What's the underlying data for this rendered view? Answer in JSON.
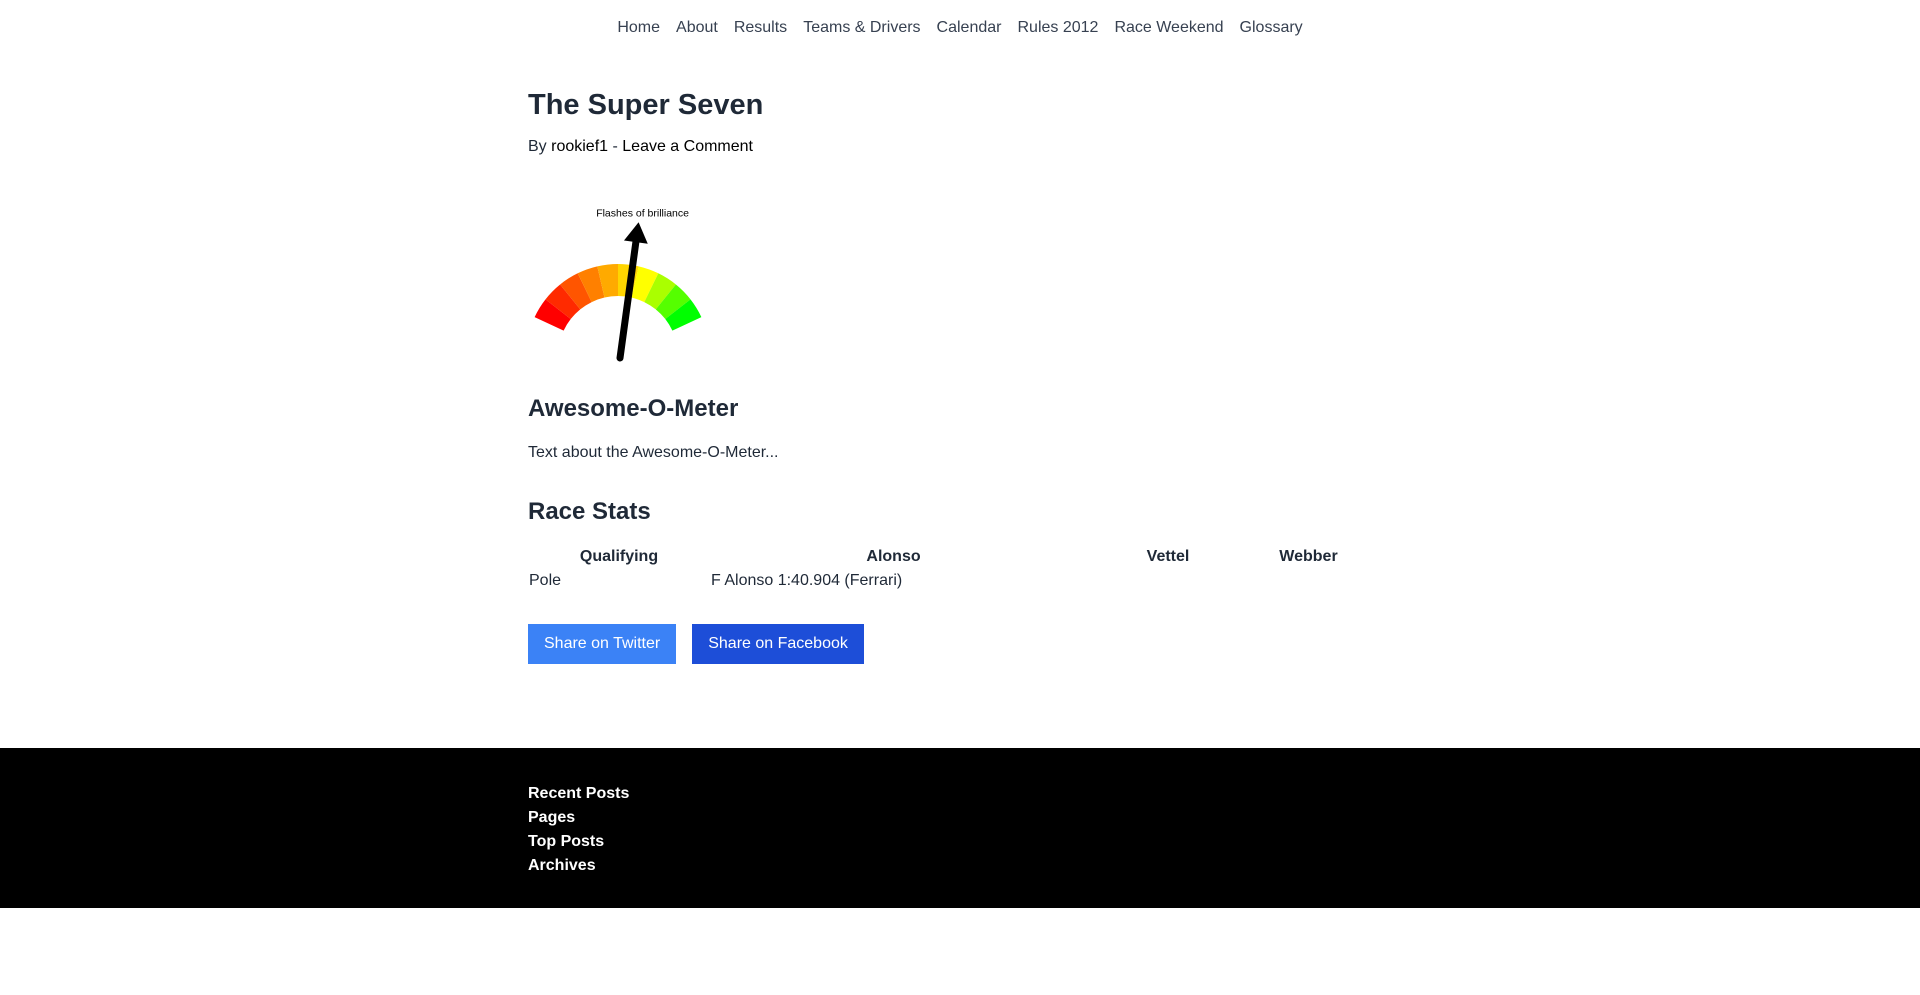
{
  "nav": {
    "items": [
      "Home",
      "About",
      "Results",
      "Teams & Drivers",
      "Calendar",
      "Rules 2012",
      "Race Weekend",
      "Glossary"
    ]
  },
  "post": {
    "title": "The Super Seven",
    "byline_prefix": "By ",
    "author": "rookief1",
    "separator": " - ",
    "comment_link": "Leave a Comment"
  },
  "gauge": {
    "label": "Flashes of brilliance",
    "level": 0.56,
    "colors_low_to_high": [
      "#ff0000",
      "#ff2a00",
      "#ff5500",
      "#ff8000",
      "#ffaa00",
      "#ffd500",
      "#ffff00",
      "#aaff00",
      "#55ff00",
      "#00ff00"
    ]
  },
  "meter": {
    "heading": "Awesome-O-Meter",
    "text": "Text about the Awesome-O-Meter..."
  },
  "stats": {
    "heading": "Race Stats",
    "columns": [
      "Qualifying",
      "Alonso",
      "Vettel",
      "Webber"
    ],
    "rows": [
      [
        "Pole",
        "F Alonso 1:40.904 (Ferrari)",
        "",
        ""
      ]
    ]
  },
  "share": {
    "twitter": "Share on Twitter",
    "facebook": "Share on Facebook"
  },
  "footer": {
    "links": [
      "Recent Posts",
      "Pages",
      "Top Posts",
      "Archives"
    ]
  }
}
